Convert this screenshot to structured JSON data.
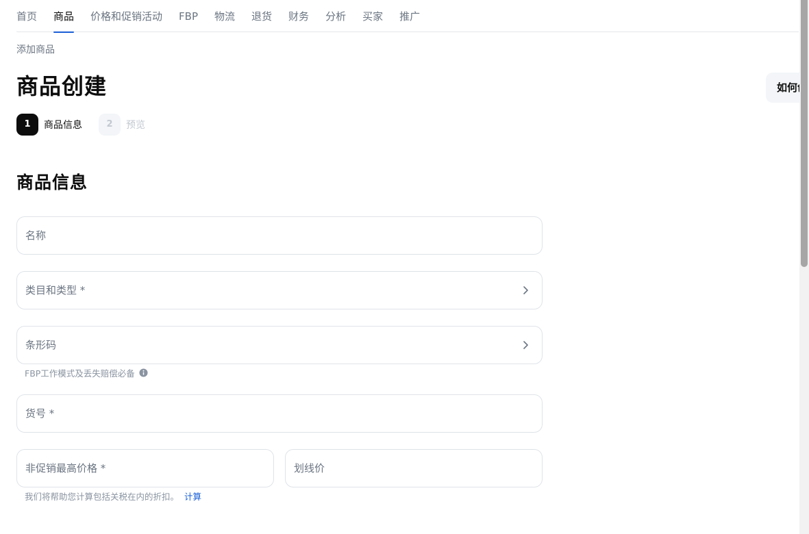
{
  "nav": {
    "items": [
      {
        "label": "首页",
        "active": false
      },
      {
        "label": "商品",
        "active": true
      },
      {
        "label": "价格和促销活动",
        "active": false
      },
      {
        "label": "FBP",
        "active": false
      },
      {
        "label": "物流",
        "active": false
      },
      {
        "label": "退货",
        "active": false
      },
      {
        "label": "财务",
        "active": false
      },
      {
        "label": "分析",
        "active": false
      },
      {
        "label": "买家",
        "active": false
      },
      {
        "label": "推广",
        "active": false
      }
    ]
  },
  "breadcrumb": "添加商品",
  "page_title": "商品创建",
  "help_button": "如何创",
  "stepper": {
    "steps": [
      {
        "number": "1",
        "label": "商品信息",
        "state": "current"
      },
      {
        "number": "2",
        "label": "预览",
        "state": "pending"
      }
    ]
  },
  "section_title": "商品信息",
  "form": {
    "name": {
      "placeholder": "名称",
      "value": ""
    },
    "category": {
      "placeholder": "类目和类型 *"
    },
    "barcode": {
      "placeholder": "条形码",
      "hint": "FBP工作模式及丢失赔偿必备"
    },
    "sku": {
      "placeholder": "货号 *",
      "value": ""
    },
    "price": {
      "placeholder": "非促销最高价格 *",
      "value": ""
    },
    "old_price": {
      "placeholder": "划线价",
      "value": ""
    },
    "price_hint": "我们将帮助您计算包括关税在内的折扣。",
    "calc_link": "计算"
  },
  "colors": {
    "accent": "#1a5fd6",
    "text_primary": "#0d0d0d",
    "text_secondary": "#6b7582",
    "border": "#dfe3e8"
  },
  "icons": {
    "chevron": "chevron-right-icon",
    "info": "info-circle-icon"
  }
}
